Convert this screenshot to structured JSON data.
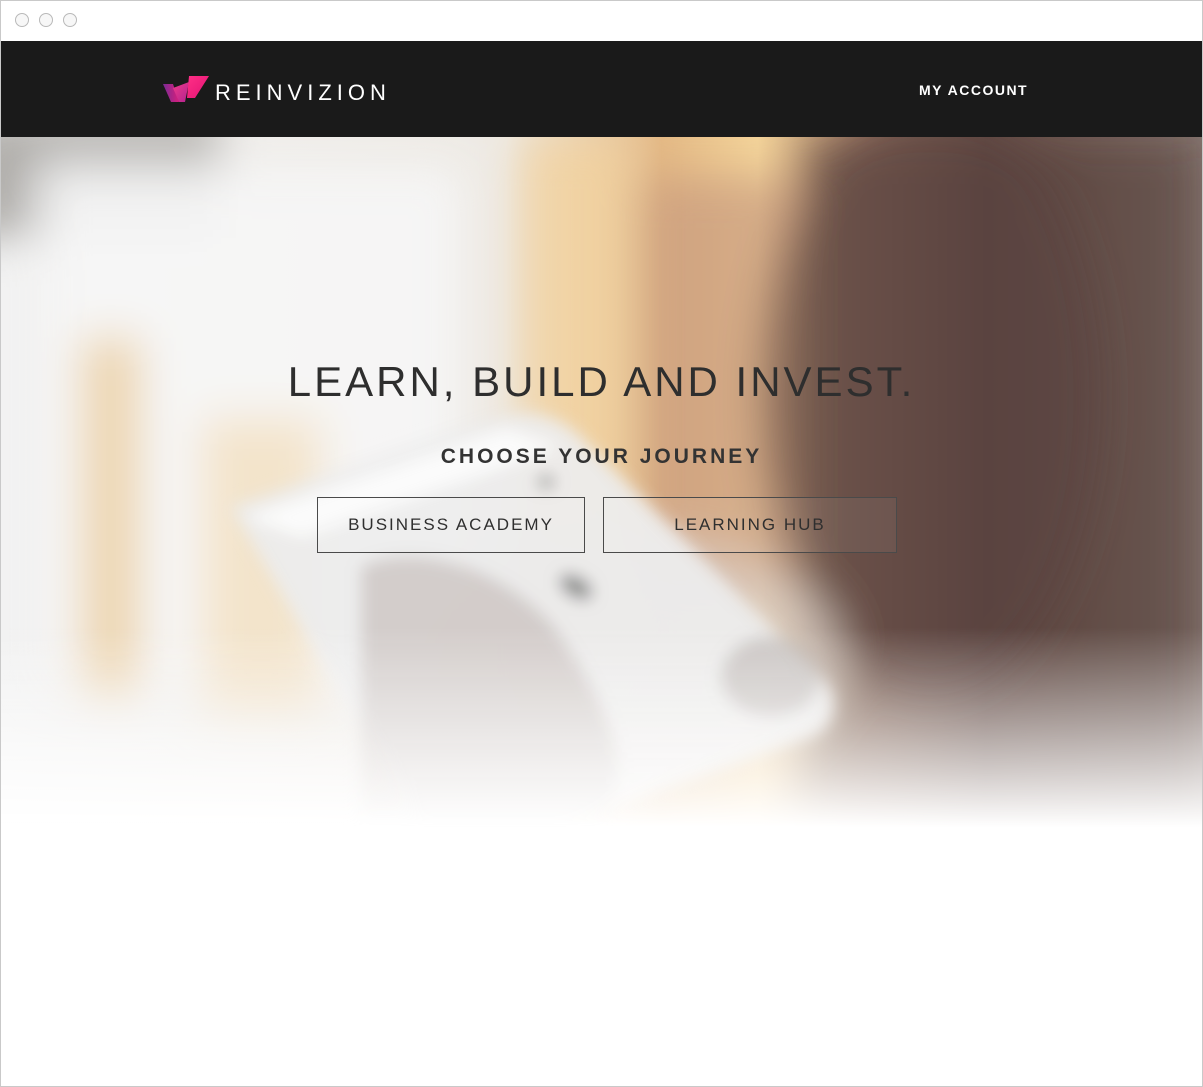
{
  "navbar": {
    "brand": "REINVIZION",
    "account_link": "MY ACCOUNT"
  },
  "hero": {
    "headline": "LEARN, BUILD AND INVEST.",
    "subhead": "CHOOSE YOUR JOURNEY",
    "buttons": [
      {
        "label": "BUSINESS ACADEMY"
      },
      {
        "label": "LEARNING HUB"
      }
    ]
  },
  "colors": {
    "navbar_bg": "#1a1a1a",
    "brand_accent_pink": "#e0267c",
    "brand_accent_purple": "#8a2a9c",
    "text_dark": "#2e2e2e"
  },
  "icons": {
    "logo": "reinvizion-logo-mark"
  }
}
